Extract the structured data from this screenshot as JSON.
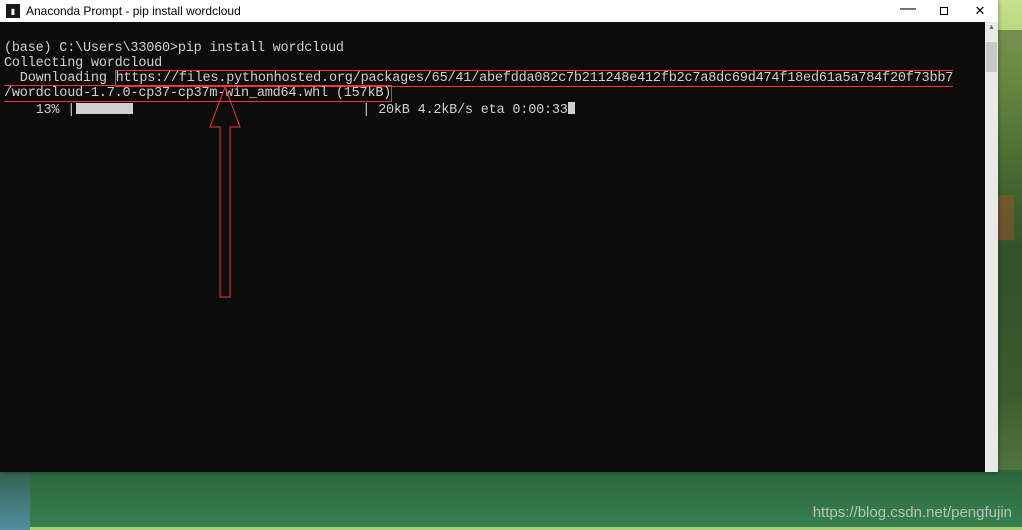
{
  "window": {
    "title": "Anaconda Prompt - pip  install wordcloud"
  },
  "terminal": {
    "prompt": "(base) C:\\Users\\33060>",
    "command": "pip install wordcloud",
    "line_collecting": "Collecting wordcloud",
    "line_download_prefix": "  Downloading ",
    "url_part1": "https://files.pythonhosted.org/packages/65/41/abefdda082c7b211248e412fb2c7a8dc69d474f18ed61a5a784f20f73bb7",
    "url_part2": "/wordcloud-1.7.0-cp37-cp37m-win_amd64.whl (157kB)",
    "progress_percent": "    13% |",
    "progress_stats": "                             | 20kB 4.2kB/s eta 0:00:33"
  },
  "footer": {
    "credit": "https://blog.csdn.net/pengfujin"
  }
}
